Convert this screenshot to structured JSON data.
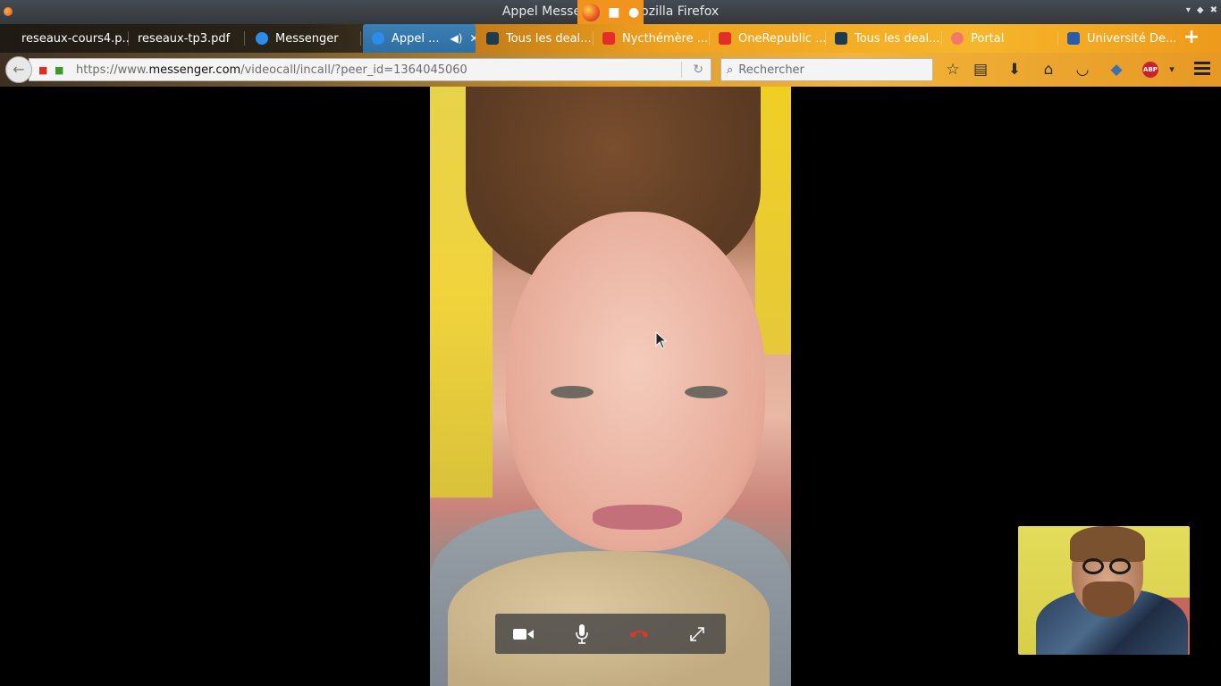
{
  "window": {
    "title": "Appel Messenger — Mozilla Firefox",
    "controls": [
      "minimize",
      "maximize",
      "close"
    ]
  },
  "tabs": [
    {
      "label": "reseaux-cours4.p...",
      "icon": "pdf-icon",
      "active": false
    },
    {
      "label": "reseaux-tp3.pdf",
      "icon": "pdf-icon",
      "active": false
    },
    {
      "label": "Messenger",
      "icon": "messenger-icon",
      "active": false
    },
    {
      "label": "Appel ...",
      "icon": "messenger-icon",
      "active": true
    },
    {
      "label": "Tous les deal...",
      "icon": "dealabs-icon",
      "active": false
    },
    {
      "label": "Nycthémère ...",
      "icon": "youtube-icon",
      "active": false
    },
    {
      "label": "OneRepublic ...",
      "icon": "youtube-icon",
      "active": false
    },
    {
      "label": "Tous les deal...",
      "icon": "dealabs-icon",
      "active": false
    },
    {
      "label": "Portal",
      "icon": "portal-icon",
      "active": false
    },
    {
      "label": "Université De...",
      "icon": "university-icon",
      "active": false
    }
  ],
  "navbar": {
    "url_prefix": "https://www.",
    "url_domain": "messenger.com",
    "url_path": "/videocall/incall/?peer_id=1364045060",
    "search_placeholder": "Rechercher"
  },
  "call": {
    "controls": [
      "camera-icon",
      "microphone-icon",
      "hang-up-icon",
      "fullscreen-icon"
    ]
  },
  "colors": {
    "accent_orange": "#f0941e",
    "active_tab": "#2f6fa3",
    "hangup_red": "#e0352b",
    "abp_red": "#c7232d"
  }
}
